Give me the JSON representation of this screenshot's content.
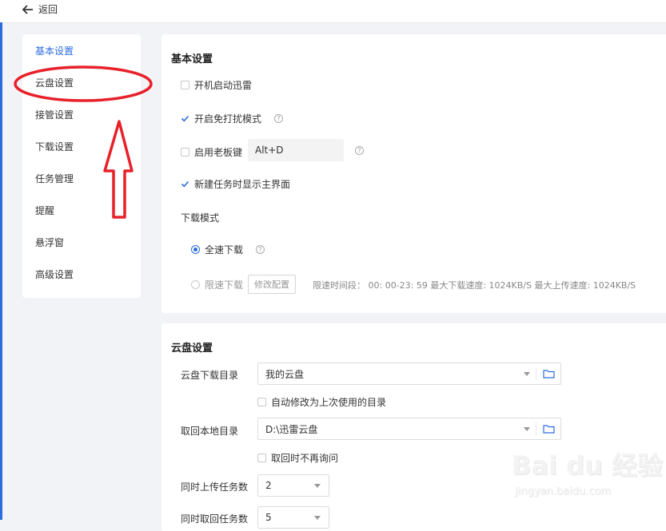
{
  "topbar": {
    "back_label": "返回"
  },
  "sidebar": {
    "items": [
      {
        "label": "基本设置",
        "active": true
      },
      {
        "label": "云盘设置",
        "active": false
      },
      {
        "label": "接管设置",
        "active": false
      },
      {
        "label": "下载设置",
        "active": false
      },
      {
        "label": "任务管理",
        "active": false
      },
      {
        "label": "提醒",
        "active": false
      },
      {
        "label": "悬浮窗",
        "active": false
      },
      {
        "label": "高级设置",
        "active": false
      }
    ]
  },
  "basic": {
    "title": "基本设置",
    "autostart": {
      "label": "开机启动迅雷",
      "checked": false
    },
    "nodisturb": {
      "label": "开启免打扰模式",
      "checked": true
    },
    "bosskey": {
      "label": "启用老板键",
      "checked": false,
      "value": "Alt+D"
    },
    "showmain": {
      "label": "新建任务时显示主界面",
      "checked": true
    },
    "download_mode": {
      "label": "下载模式",
      "fullspeed": {
        "label": "全速下载",
        "selected": true
      },
      "limited": {
        "label": "限速下载",
        "selected": false,
        "button": "修改配置"
      },
      "info": "限速时间段： 00: 00-23: 59   最大下载速度: 1024KB/S     最大上传速度: 1024KB/S"
    }
  },
  "cloud": {
    "title": "云盘设置",
    "download_dir": {
      "label": "云盘下载目录",
      "value": "我的云盘"
    },
    "auto_modify": {
      "label": "自动修改为上次使用的目录",
      "checked": false
    },
    "local_dir": {
      "label": "取回本地目录",
      "value": "D:\\迅雷云盘"
    },
    "no_ask": {
      "label": "取回时不再询问",
      "checked": false
    },
    "upload_tasks": {
      "label": "同时上传任务数",
      "value": "2"
    },
    "fetch_tasks": {
      "label": "同时取回任务数",
      "value": "5"
    }
  },
  "watermark": {
    "logo": "Bai du 经验",
    "site": "jingyan.baidu.com"
  },
  "colors": {
    "accent": "#2d6be0",
    "annotation": "#e8202a"
  }
}
